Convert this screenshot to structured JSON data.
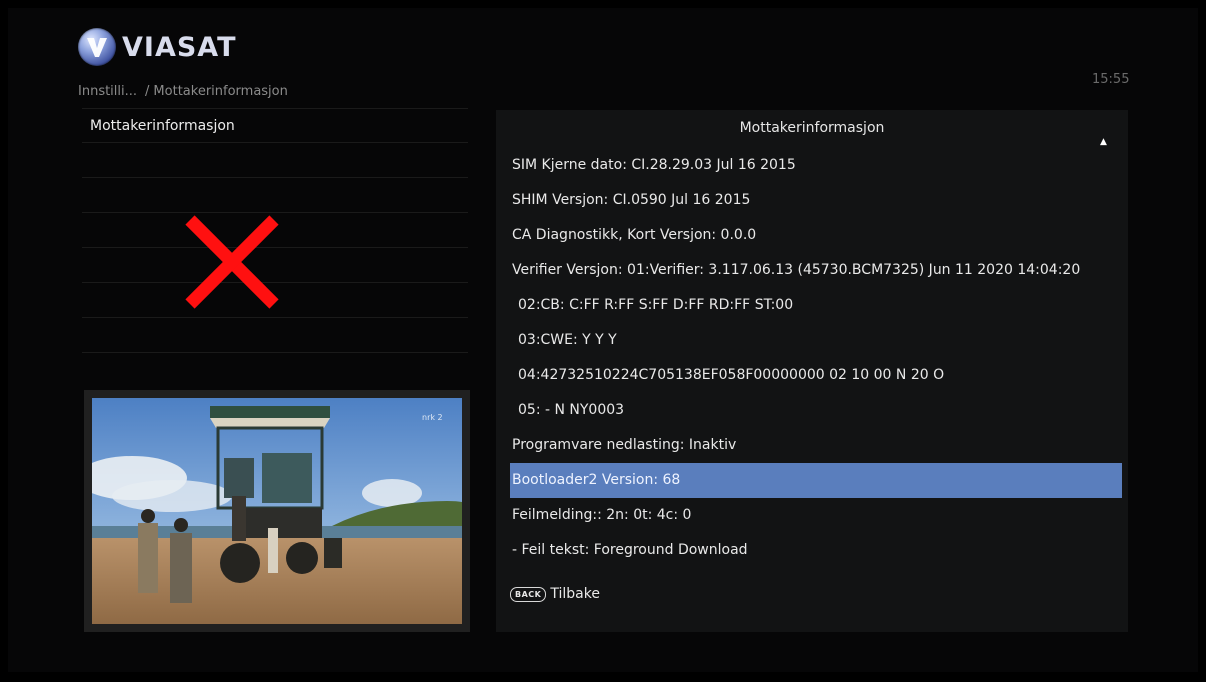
{
  "header": {
    "brand": "VIASAT",
    "breadcrumb": [
      "Innstilli...",
      "Mottakerinformasjon"
    ],
    "clock": "15:55"
  },
  "left_menu": {
    "items": [
      "Mottakerinformasjon"
    ]
  },
  "preview": {
    "channel_logo": "nrk 2"
  },
  "panel": {
    "title": "Mottakerinformasjon",
    "scroll_indicator": "▲",
    "rows": [
      "SIM Kjerne dato: CI.28.29.03 Jul 16 2015",
      "SHIM Versjon: CI.0590 Jul 16 2015",
      "CA Diagnostikk, Kort Versjon: 0.0.0",
      "Verifier Versjon:  01:Verifier: 3.117.06.13 (45730.BCM7325) Jun 11 2020 14:04:20",
      "02:CB: C:FF R:FF S:FF D:FF RD:FF ST:00",
      "03:CWE: Y Y Y",
      "04:42732510224C705138EF058F00000000 02 10 00 N 20 O",
      "05: - N NY0003",
      "Programvare nedlasting: Inaktiv",
      "Bootloader2 Version: 68",
      "Feilmelding:: 2n:  0t:  4c:  0",
      "- Feil tekst: Foreground Download"
    ],
    "selected_index": 9,
    "back_key": "BACK",
    "back_label": "Tilbake"
  }
}
